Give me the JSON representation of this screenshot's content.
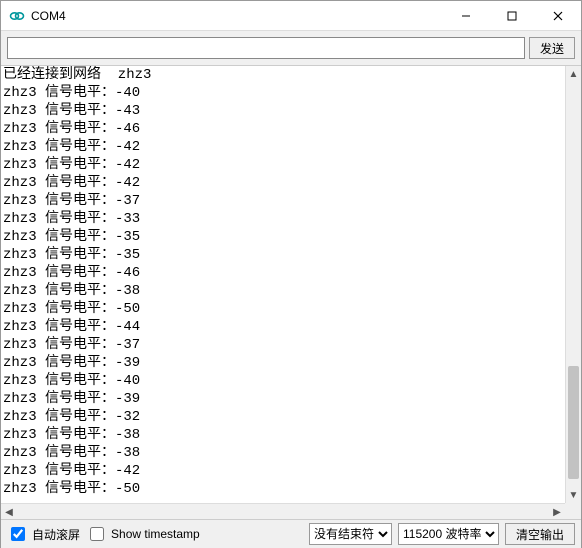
{
  "window": {
    "title": "COM4"
  },
  "toolbar": {
    "input_value": "",
    "send_label": "发送"
  },
  "output": {
    "first_line": "已经连接到网络  zhz3",
    "prefix": "zhz3 信号电平：",
    "values": [
      -40,
      -43,
      -46,
      -42,
      -42,
      -42,
      -37,
      -33,
      -35,
      -35,
      -46,
      -38,
      -50,
      -44,
      -37,
      -39,
      -40,
      -39,
      -32,
      -38,
      -38,
      -42,
      -50
    ]
  },
  "footer": {
    "autoscroll_label": "自动滚屏",
    "autoscroll_checked": true,
    "timestamp_label": "Show timestamp",
    "timestamp_checked": false,
    "line_ending_options": [
      "没有结束符"
    ],
    "line_ending_selected": "没有结束符",
    "baud_options": [
      "115200 波特率"
    ],
    "baud_selected": "115200 波特率",
    "clear_label": "清空输出"
  }
}
